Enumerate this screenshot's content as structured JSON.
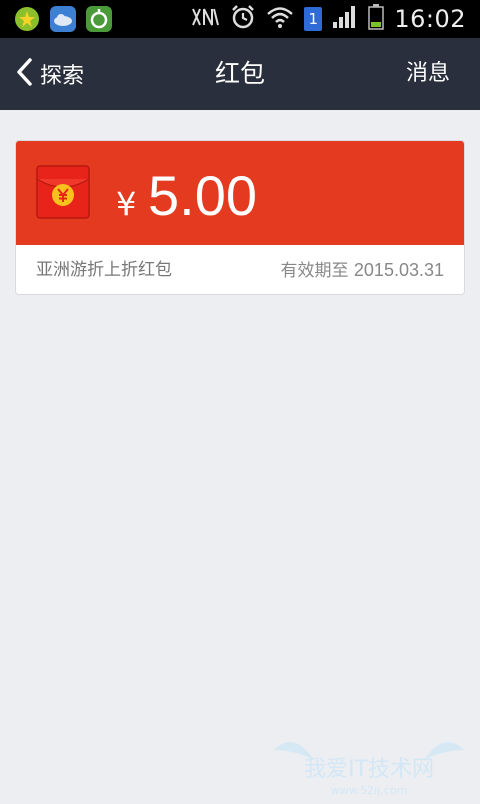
{
  "status_bar": {
    "time": "16:02",
    "sim_slot": "1",
    "icons": [
      "app-360-icon",
      "weather-icon",
      "unlock-icon",
      "nfc-off-icon",
      "alarm-icon",
      "wifi-icon",
      "signal-icon",
      "battery-icon"
    ]
  },
  "header": {
    "back_label": "探索",
    "title": "红包",
    "messages_label": "消息"
  },
  "red_packet": {
    "currency_symbol": "¥",
    "amount": "5.00",
    "name": "亚洲游折上折红包",
    "expiry_prefix": "有效期至",
    "expiry_date": "2015.03.31",
    "colors": {
      "card_red": "#e33a20",
      "envelope_red": "#e8241a",
      "coin_gold": "#f6c21b"
    }
  },
  "watermark": {
    "text": "我爱IT技术网",
    "url": "www.52ij.com"
  },
  "colors": {
    "header_bg": "#292f3c",
    "page_bg": "#eceef2",
    "status_bg": "#000000"
  }
}
